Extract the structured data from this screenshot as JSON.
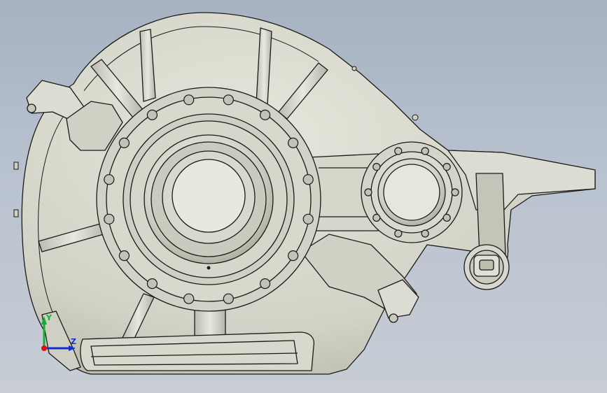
{
  "viewport": {
    "background_top": "#a6b2c2",
    "background_bottom": "#c8cdd5"
  },
  "triad": {
    "y_label": "Y",
    "z_label": "Z",
    "x_color": "#e01010",
    "y_color": "#10b030",
    "z_color": "#1030d0"
  },
  "model": {
    "body_color": "#d4d4c8",
    "edge_color": "#1a1a1a",
    "shade_color": "#a9a99c"
  }
}
